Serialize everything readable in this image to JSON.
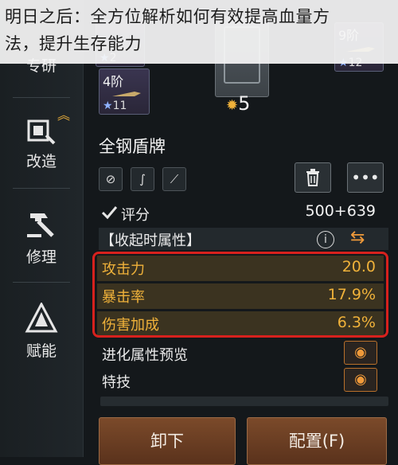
{
  "caption": {
    "line1": "明日之后：全方位解析如何有效提高血量方",
    "line2": "法，提升生存能力"
  },
  "sidebar": {
    "items": [
      {
        "label": "专研",
        "icon": "research-icon"
      },
      {
        "label": "改造",
        "icon": "modify-icon"
      },
      {
        "label": "修理",
        "icon": "repair-hammer-icon"
      },
      {
        "label": "赋能",
        "icon": "empower-icon"
      }
    ]
  },
  "cards": {
    "left_partial": {
      "tier": "?阶",
      "count": "2"
    },
    "tier4": {
      "tier": "4阶",
      "count": "11"
    },
    "tier9": {
      "tier": "9阶",
      "count": "12"
    },
    "vault_count": "5"
  },
  "item": {
    "name": "全钢盾牌",
    "score_label": "评分",
    "score_value": "500+639",
    "section_title": "【收起时属性】"
  },
  "stats": [
    {
      "name": "攻击力",
      "value": "20.0"
    },
    {
      "name": "暴击率",
      "value": "17.9%"
    },
    {
      "name": "伤害加成",
      "value": "6.3%"
    }
  ],
  "extras": [
    {
      "label": "进化属性预览"
    },
    {
      "label": "特技"
    }
  ],
  "buttons": {
    "unequip": "卸下",
    "config": "配置(F)",
    "more": "•••"
  },
  "colors": {
    "accent_orange": "#f0b23a",
    "highlight_red": "#d7211d",
    "button_brown": "#6b3f24"
  }
}
